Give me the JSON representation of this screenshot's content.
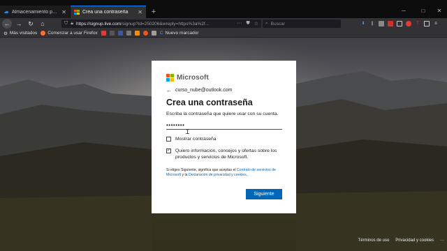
{
  "browser": {
    "tabs": [
      {
        "title": "Almacenamiento personal en",
        "active": false
      },
      {
        "title": "Crea una contraseña",
        "active": true
      }
    ],
    "new_tab": "+",
    "window_controls": {
      "minimize": "─",
      "maximize": "□",
      "close": "✕"
    },
    "url_main": "https://signup.live.com",
    "url_rest": "/signup?id=250206&wreply=https%3a%2f...",
    "search_placeholder": "Buscar",
    "bookmarks": [
      {
        "label": "Más visitados",
        "icon": "gear-icon"
      },
      {
        "label": "Comenzar a usar Firefox",
        "icon": "firefox-icon"
      },
      {
        "label": "Nuevo marcador",
        "icon": "bookmark-icon"
      }
    ]
  },
  "dialog": {
    "brand": "Microsoft",
    "identity": "curso_nube@outlook.com",
    "title": "Crea una contraseña",
    "description": "Escriba la contraseña que quiere usar con su cuenta.",
    "password_value": "••••••••",
    "show_password_label": "Mostrar contraseña",
    "show_password_checked": false,
    "offers_label": "Quiero información, consejos y ofertas sobre los productos y servicios de Microsoft.",
    "offers_checked": true,
    "legal_prefix": "Si eliges Siguiente, significa que aceptas el ",
    "legal_link1": "Contrato de servicios de Microsoft",
    "legal_mid": " y la ",
    "legal_link2": "Declaración de privacidad y cookies",
    "legal_suffix": ".",
    "next_button": "Siguiente"
  },
  "footer": {
    "terms": "Términos de uso",
    "privacy": "Privacidad y cookies",
    "more": "···"
  },
  "colors": {
    "accent": "#0067b8",
    "ms_red": "#f25022",
    "ms_green": "#7fba00",
    "ms_blue": "#00a4ef",
    "ms_yellow": "#ffb900"
  }
}
